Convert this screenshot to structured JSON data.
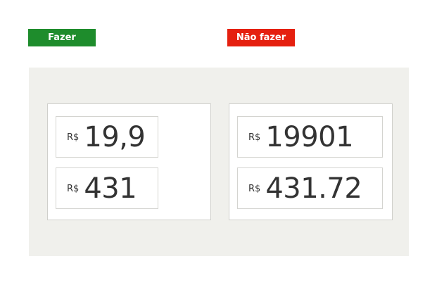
{
  "labels": {
    "do": "Fazer",
    "dont": "Não fazer"
  },
  "colors": {
    "do": "#1e8c2c",
    "dont": "#e5200f",
    "stage_background": "#f0f0ec"
  },
  "do_examples": [
    {
      "currency": "R$",
      "amount": "19,9"
    },
    {
      "currency": "R$",
      "amount": "431"
    }
  ],
  "dont_examples": [
    {
      "currency": "R$",
      "amount": "19901"
    },
    {
      "currency": "R$",
      "amount": "431.72"
    }
  ]
}
